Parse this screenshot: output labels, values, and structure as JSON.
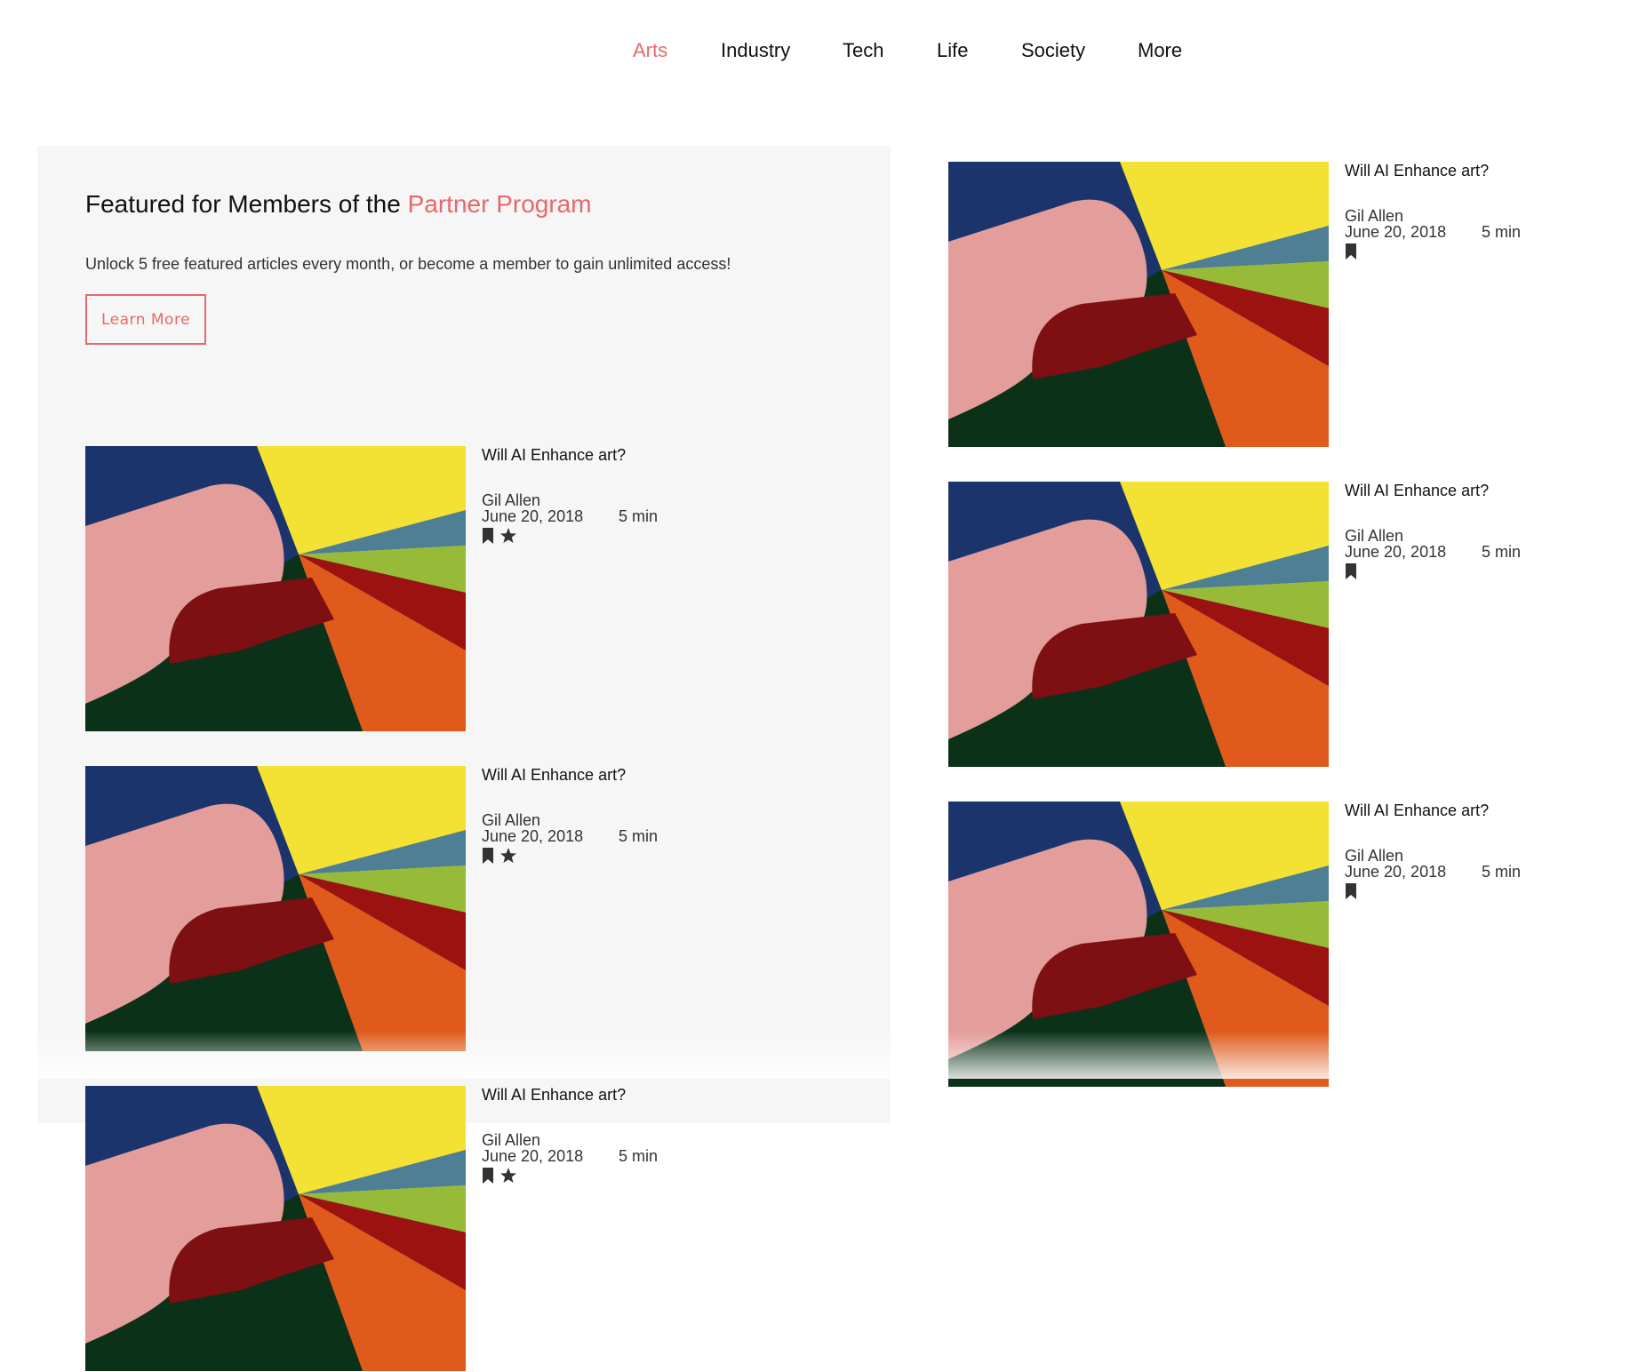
{
  "nav": {
    "items": [
      {
        "label": "Arts",
        "active": true
      },
      {
        "label": "Industry",
        "active": false
      },
      {
        "label": "Tech",
        "active": false
      },
      {
        "label": "Life",
        "active": false
      },
      {
        "label": "Society",
        "active": false
      },
      {
        "label": "More",
        "active": false
      }
    ],
    "active_color": "#e8686a"
  },
  "featured": {
    "title_prefix": "Featured for Members of the",
    "title_accent": "Partner Program",
    "description": "Unlock 5 free featured articles every month, or become a member to gain unlimited access!",
    "learn_more_label": "Learn More",
    "accent_color": "#e8686a"
  },
  "featured_articles": [
    {
      "title": "Will AI Enhance art?",
      "author": "Gil Allen",
      "date": "June 20, 2018",
      "read_time": "5 min",
      "icons": [
        "bookmark-icon",
        "star-icon"
      ]
    },
    {
      "title": "Will AI Enhance art?",
      "author": "Gil Allen",
      "date": "June 20, 2018",
      "read_time": "5 min",
      "icons": [
        "bookmark-icon",
        "star-icon"
      ]
    },
    {
      "title": "Will AI Enhance art?",
      "author": "Gil Allen",
      "date": "June 20, 2018",
      "read_time": "5 min",
      "icons": [
        "bookmark-icon",
        "star-icon"
      ]
    }
  ],
  "articles": [
    {
      "title": "Will AI Enhance art?",
      "author": "Gil Allen",
      "date": "June 20, 2018",
      "read_time": "5 min",
      "icons": [
        "bookmark-icon"
      ]
    },
    {
      "title": "Will AI Enhance art?",
      "author": "Gil Allen",
      "date": "June 20, 2018",
      "read_time": "5 min",
      "icons": [
        "bookmark-icon"
      ]
    },
    {
      "title": "Will AI Enhance art?",
      "author": "Gil Allen",
      "date": "June 20, 2018",
      "read_time": "5 min",
      "icons": [
        "bookmark-icon"
      ]
    }
  ]
}
